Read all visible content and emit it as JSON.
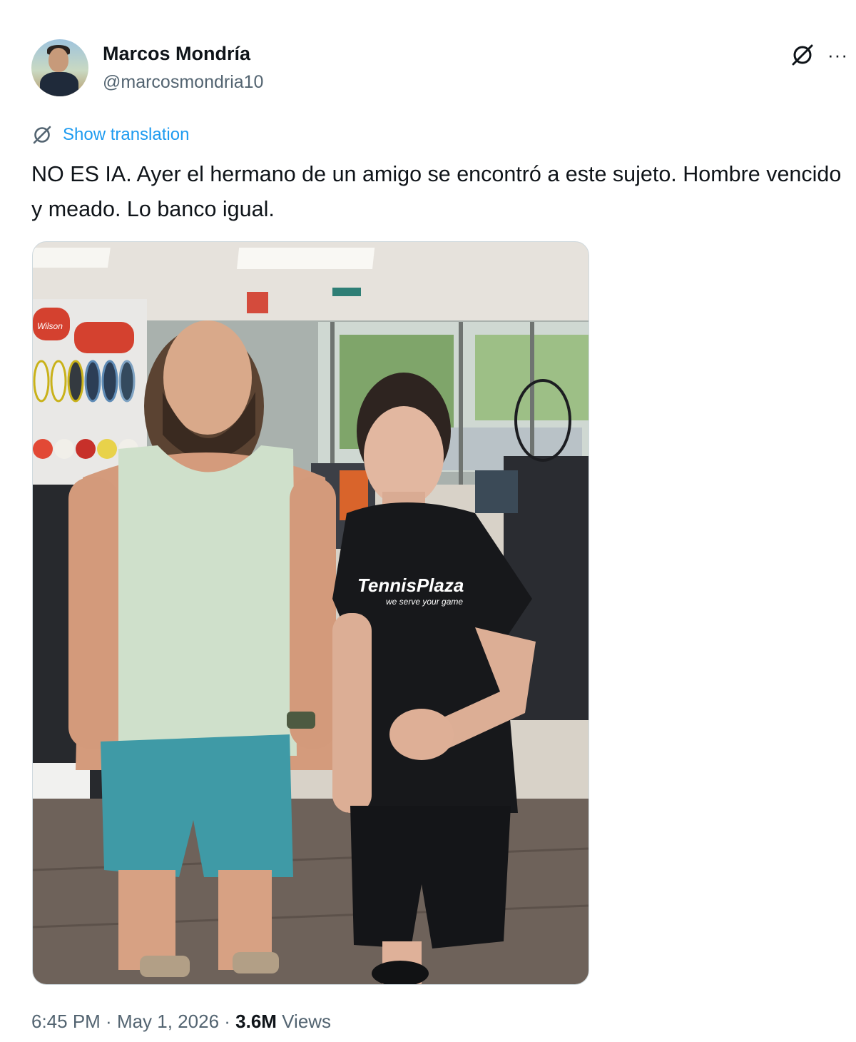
{
  "author": {
    "display_name": "Marcos Mondría",
    "handle": "@marcosmondria10"
  },
  "icons": {
    "grok": "grok-icon",
    "more": "more-icon",
    "translate": "translate-icon"
  },
  "translation": {
    "label": "Show translation"
  },
  "tweet": {
    "text": "NO ES IA. Ayer el hermano de un amigo se encontró a este sujeto. Hombre vencido y meado. Lo banco igual."
  },
  "photo": {
    "racket_brand": "Wilson",
    "shirt_logo": "TennisPlaza",
    "shirt_tagline": "we serve your game"
  },
  "meta": {
    "time": "6:45 PM",
    "sep1": " · ",
    "date": "May 1, 2026",
    "sep2": " · ",
    "views_count": "3.6M",
    "views_label": " Views"
  },
  "colors": {
    "text_primary": "#0f1419",
    "text_secondary": "#536471",
    "link": "#1d9bf0",
    "border": "#cfd9de"
  }
}
